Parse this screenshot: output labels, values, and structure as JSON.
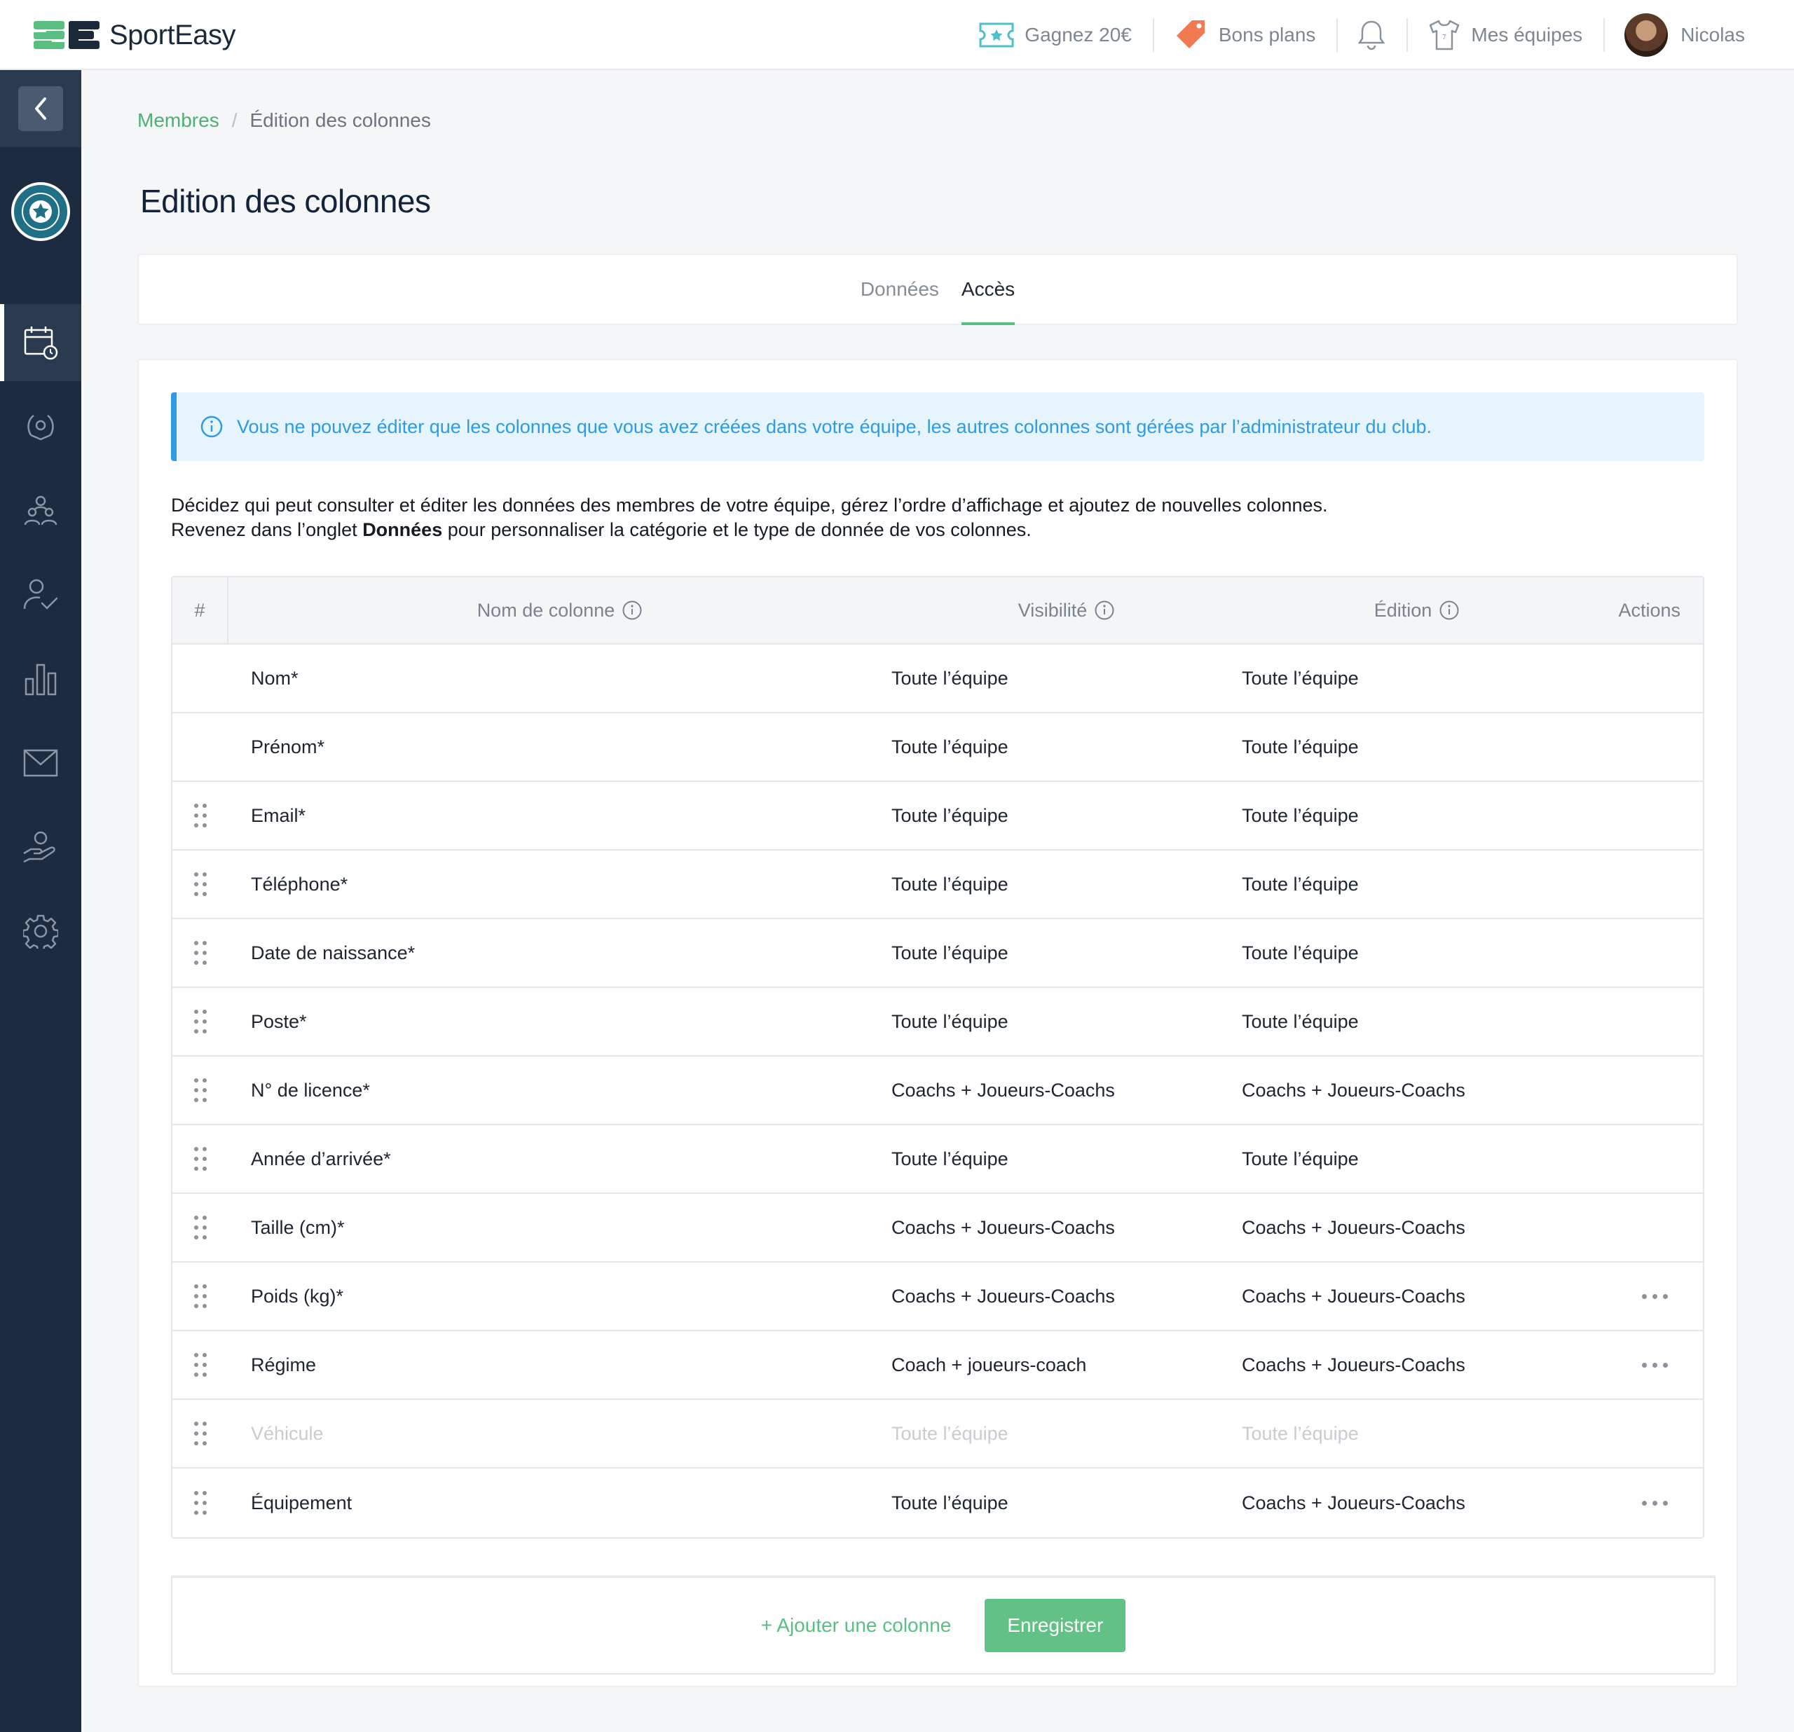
{
  "brand": {
    "name": "SportEasy"
  },
  "topnav": {
    "earn": "Gagnez 20€",
    "deals": "Bons plans",
    "teams": "Mes équipes",
    "user": "Nicolas"
  },
  "breadcrumb": {
    "parent": "Membres",
    "separator": "/",
    "current": "Édition des colonnes"
  },
  "page": {
    "title": "Edition des colonnes"
  },
  "tabs": [
    {
      "label": "Données"
    },
    {
      "label": "Accès"
    }
  ],
  "info": {
    "text": "Vous ne pouvez éditer que les colonnes que vous avez créées dans votre équipe, les autres colonnes sont gérées par l’administrateur du club."
  },
  "description": {
    "line1": "Décidez qui peut consulter et éditer les données des membres de votre équipe, gérez l’ordre d’affichage et ajoutez de nouvelles colonnes.",
    "line2_prefix": "Revenez dans l’onglet ",
    "line2_bold": "Données",
    "line2_suffix": " pour personnaliser la catégorie et le type de donnée de vos colonnes."
  },
  "table": {
    "headers": {
      "hash": "#",
      "name": "Nom de colonne",
      "visibility": "Visibilité",
      "edition": "Édition",
      "actions": "Actions"
    },
    "rows": [
      {
        "name": "Nom*",
        "visibility": "Toute l’équipe",
        "edition": "Toute l’équipe"
      },
      {
        "name": "Prénom*",
        "visibility": "Toute l’équipe",
        "edition": "Toute l’équipe"
      },
      {
        "name": "Email*",
        "visibility": "Toute l’équipe",
        "edition": "Toute l’équipe"
      },
      {
        "name": "Téléphone*",
        "visibility": "Toute l’équipe",
        "edition": "Toute l’équipe"
      },
      {
        "name": "Date de naissance*",
        "visibility": "Toute l’équipe",
        "edition": "Toute l’équipe"
      },
      {
        "name": "Poste*",
        "visibility": "Toute l’équipe",
        "edition": "Toute l’équipe"
      },
      {
        "name": "N° de licence*",
        "visibility": "Coachs + Joueurs-Coachs",
        "edition": "Coachs + Joueurs-Coachs"
      },
      {
        "name": "Année d’arrivée*",
        "visibility": "Toute l’équipe",
        "edition": "Toute l’équipe"
      },
      {
        "name": "Taille (cm)*",
        "visibility": "Coachs + Joueurs-Coachs",
        "edition": "Coachs + Joueurs-Coachs"
      },
      {
        "name": "Poids (kg)*",
        "visibility": "Coachs + Joueurs-Coachs",
        "edition": "Coachs + Joueurs-Coachs"
      },
      {
        "name": "Régime",
        "visibility": "Coach + joueurs-coach",
        "edition": "Coachs + Joueurs-Coachs"
      },
      {
        "name": "Véhicule",
        "visibility": "Toute l’équipe",
        "edition": "Toute l’équipe"
      },
      {
        "name": "Équipement",
        "visibility": "Toute l’équipe",
        "edition": "Coachs + Joueurs-Coachs"
      }
    ]
  },
  "footer": {
    "add_column": "+ Ajouter une colonne",
    "save": "Enregistrer"
  },
  "colors": {
    "accent": "#5abf82",
    "sidebar": "#1c2b3f",
    "info": "#2f9be3",
    "deal": "#f07b52"
  }
}
